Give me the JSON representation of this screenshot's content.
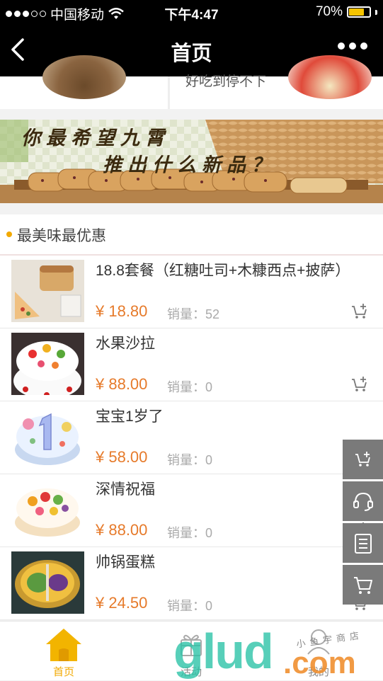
{
  "status_bar": {
    "carrier": "中国移动",
    "time": "下午4:47",
    "battery": "70%",
    "battery_level": 0.7
  },
  "nav": {
    "title": "首页"
  },
  "top_strip": {
    "partial_text": "好吃到停不下"
  },
  "banner": {
    "line1": "你最希望九霄",
    "line2": "推出什么新品？"
  },
  "section": {
    "title": "最美味最优惠"
  },
  "products": [
    {
      "name": "18.8套餐（红糖吐司+木糠西点+披萨）",
      "price": "¥ 18.80",
      "sales_label": "销量：",
      "sales": "52"
    },
    {
      "name": "水果沙拉",
      "price": "¥ 88.00",
      "sales_label": "销量：",
      "sales": "0"
    },
    {
      "name": "宝宝1岁了",
      "price": "¥ 58.00",
      "sales_label": "销量：",
      "sales": "0"
    },
    {
      "name": "深情祝福",
      "price": "¥ 88.00",
      "sales_label": "销量：",
      "sales": "0"
    },
    {
      "name": "帅锅蛋糕",
      "price": "¥ 24.50",
      "sales_label": "销量：",
      "sales": "0"
    }
  ],
  "tabs": [
    {
      "label": "首页",
      "active": true
    },
    {
      "label": "活动",
      "active": false
    },
    {
      "label": "我的",
      "active": false
    }
  ],
  "watermark": {
    "main": "glud",
    "suffix": ".com",
    "small": "小鱼宇商店"
  },
  "colors": {
    "accent": "#f2a900",
    "price": "#e67a2a",
    "float_button": "#7a7a7a"
  }
}
